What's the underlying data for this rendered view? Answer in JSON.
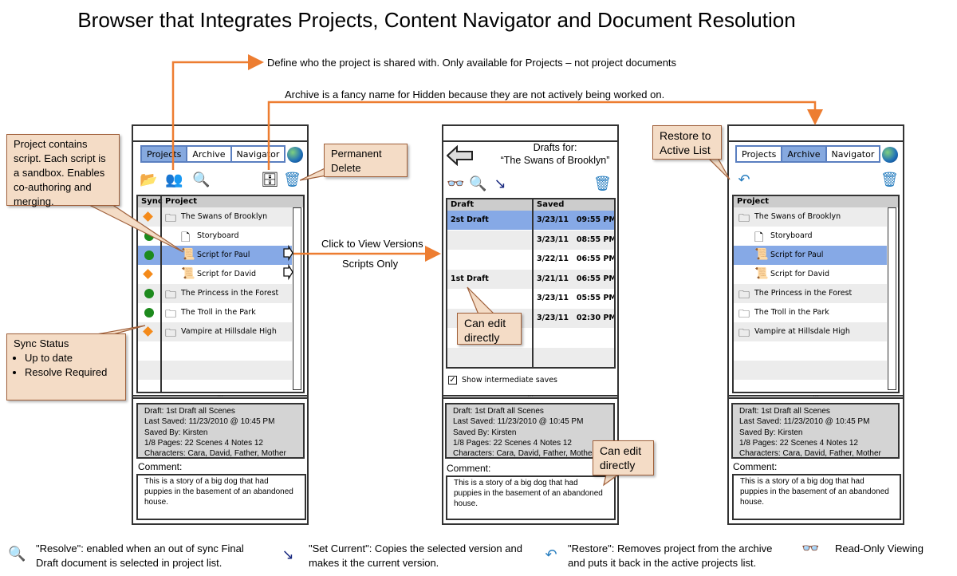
{
  "title": "Browser that Integrates Projects, Content Navigator and Document Resolution",
  "notes": {
    "share": "Define who the project is shared with.  Only available for Projects – not project documents",
    "archive": "Archive is a fancy name for Hidden because they are not actively being worked on.",
    "click_versions": "Click to View Versions",
    "scripts_only": "Scripts Only"
  },
  "callouts": {
    "project_script": "Project contains script. Each script is a sandbox.  Enables co-authoring and merging.",
    "permanent_delete": "Permanent Delete",
    "sync_title": "Sync Status",
    "sync_items": [
      "Up to date",
      "Resolve Required"
    ],
    "can_edit": "Can edit directly",
    "can_edit2": "Can edit directly",
    "restore": "Restore to Active List"
  },
  "tabs": [
    "Projects",
    "Archive",
    "Navigator"
  ],
  "colors": {
    "accent": "#ed7d31",
    "selected": "#86a9e6",
    "ok": "#1d8a1d",
    "warn": "#f48a1a",
    "callout": "#f4dcc6"
  },
  "project_table": {
    "headers": {
      "sync": "Sync",
      "project": "Project"
    },
    "rows": [
      {
        "label": "The Swans of Brooklyn",
        "type": "folder",
        "sync": "warn",
        "indent": 0
      },
      {
        "label": "Storyboard",
        "type": "doc",
        "sync": "ok",
        "indent": 1
      },
      {
        "label": "Script for Paul",
        "type": "script",
        "sync": "ok",
        "indent": 1,
        "selected": true,
        "arrow": true
      },
      {
        "label": "Script for David",
        "type": "script",
        "sync": "warn",
        "indent": 1,
        "arrow": true
      },
      {
        "label": "The Princess in the Forest",
        "type": "folder",
        "sync": "ok",
        "indent": 0
      },
      {
        "label": "The Troll in the Park",
        "type": "folder",
        "sync": "ok",
        "indent": 0
      },
      {
        "label": "Vampire at Hillsdale High",
        "type": "folder",
        "sync": "warn",
        "indent": 0
      }
    ]
  },
  "archive_table": {
    "headers": {
      "project": "Project"
    },
    "rows": [
      {
        "label": "The Swans of Brooklyn",
        "type": "folder",
        "indent": 0
      },
      {
        "label": "Storyboard",
        "type": "doc",
        "indent": 1
      },
      {
        "label": "Script for Paul",
        "type": "script",
        "indent": 1,
        "selected": true
      },
      {
        "label": "Script for David",
        "type": "script",
        "indent": 1
      },
      {
        "label": "The Princess in the Forest",
        "type": "folder",
        "indent": 0
      },
      {
        "label": "The Troll in the Park",
        "type": "folder",
        "indent": 0
      },
      {
        "label": "Vampire at Hillsdale High",
        "type": "folder",
        "indent": 0
      }
    ]
  },
  "drafts": {
    "title_line1": "Drafts for:",
    "title_line2": "“The Swans of Brooklyn”",
    "headers": {
      "draft": "Draft",
      "saved": "Saved"
    },
    "rows": [
      {
        "draft": "2st Draft",
        "saved": "3/23/11   09:55 PM",
        "selected": true
      },
      {
        "draft": "",
        "saved": "3/23/11   08:55 PM"
      },
      {
        "draft": "",
        "saved": "3/22/11   06:55 PM"
      },
      {
        "draft": "1st Draft",
        "saved": "3/21/11   06:55 PM"
      },
      {
        "draft": "",
        "saved": "3/23/11   05:55 PM"
      },
      {
        "draft": "",
        "saved": "3/23/11   02:30 PM"
      },
      {
        "draft": "",
        "saved": ""
      },
      {
        "draft": "",
        "saved": ""
      }
    ],
    "show_intermediate": "Show intermediate saves",
    "show_intermediate_checked": true
  },
  "info": {
    "draft": "Draft: 1st Draft all Scenes",
    "last_saved": "Last Saved: 11/23/2010 @ 10:45 PM",
    "saved_by": "Saved By: Kirsten",
    "pages": "1/8 Pages: 22  Scenes 4    Notes 12",
    "characters": "Characters: Cara, David, Father, Mother"
  },
  "comment": {
    "label": "Comment:",
    "text": "This is a story of a big dog that had puppies in the basement of an abandoned house."
  },
  "legend": [
    {
      "icon": "resolve-icon",
      "text": "\"Resolve\": enabled when an out of sync Final Draft document is selected in project list."
    },
    {
      "icon": "set-current-icon",
      "text": "\"Set Current\": Copies the selected version and makes it the current version."
    },
    {
      "icon": "restore-icon",
      "text": "\"Restore\": Removes project from the archive and puts it back in the active projects list."
    },
    {
      "icon": "glasses-icon",
      "text": "Read-Only Viewing"
    }
  ]
}
